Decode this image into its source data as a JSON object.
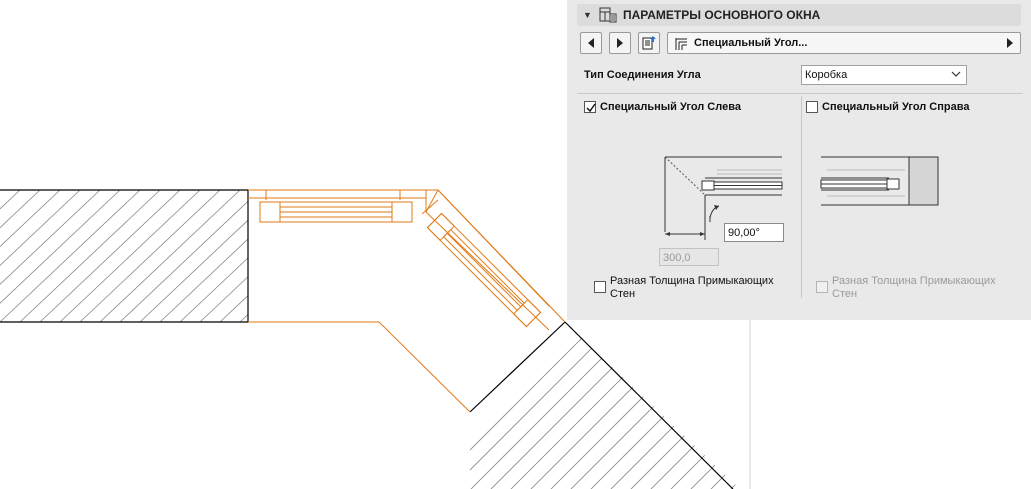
{
  "panel": {
    "header_title": "ПАРАМЕТРЫ ОСНОВНОГО ОКНА",
    "header_collapse_icon": "triangle-down-icon",
    "header_icon": "window-settings-icon",
    "nav": {
      "prev_icon": "arrow-left-icon",
      "next_icon": "arrow-right-icon",
      "favorites_icon": "favorites-icon",
      "selector_icon": "special-angle-icon",
      "selector_label": "Специальный Угол...",
      "selector_arrow_icon": "chevron-right-icon"
    },
    "joint_type_label": "Тип Соединения Угла",
    "joint_type_value": "Коробка",
    "left": {
      "checkbox_label": "Специальный Угол Слева",
      "checked": true,
      "angle_value": "90,00°",
      "width_value": "300,0",
      "diff_thickness_label": "Разная Толщина Примыкающих Стен",
      "diff_thickness_checked": false
    },
    "right": {
      "checkbox_label": "Специальный Угол Справа",
      "checked": false,
      "diff_thickness_label": "Разная Толщина Примыкающих Стен",
      "diff_thickness_checked": false,
      "diff_thickness_disabled": true
    }
  },
  "colors": {
    "window_lines": "#e07a16",
    "wall_lines": "#000000",
    "panel_bg": "#e9e9e9"
  }
}
